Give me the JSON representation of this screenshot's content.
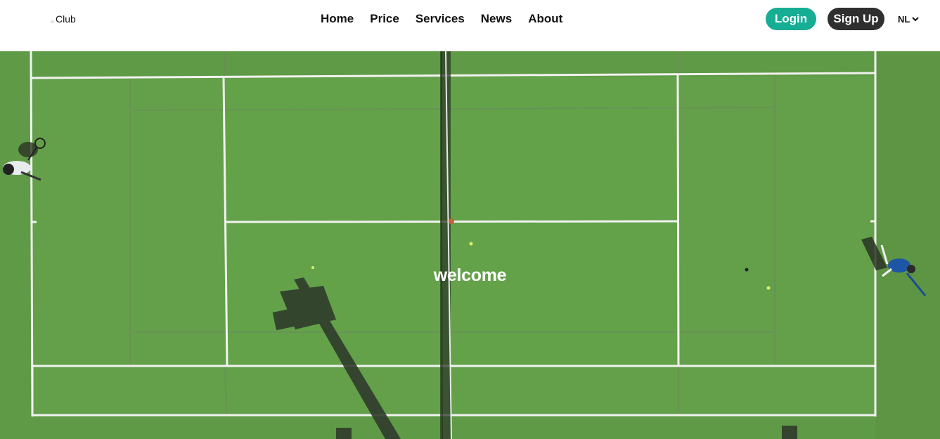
{
  "header": {
    "brand": "Club",
    "nav": [
      {
        "label": "Home"
      },
      {
        "label": "Price"
      },
      {
        "label": "Services"
      },
      {
        "label": "News"
      },
      {
        "label": "About"
      }
    ],
    "login_label": "Login",
    "signup_label": "Sign Up",
    "language": "NL",
    "language_icon": "chevron-down-icon"
  },
  "hero": {
    "title": "welcome",
    "image": "aerial-tennis-court"
  },
  "colors": {
    "login": "#15ad93",
    "signup": "#2f2f2f",
    "court": "#5f9b46"
  }
}
